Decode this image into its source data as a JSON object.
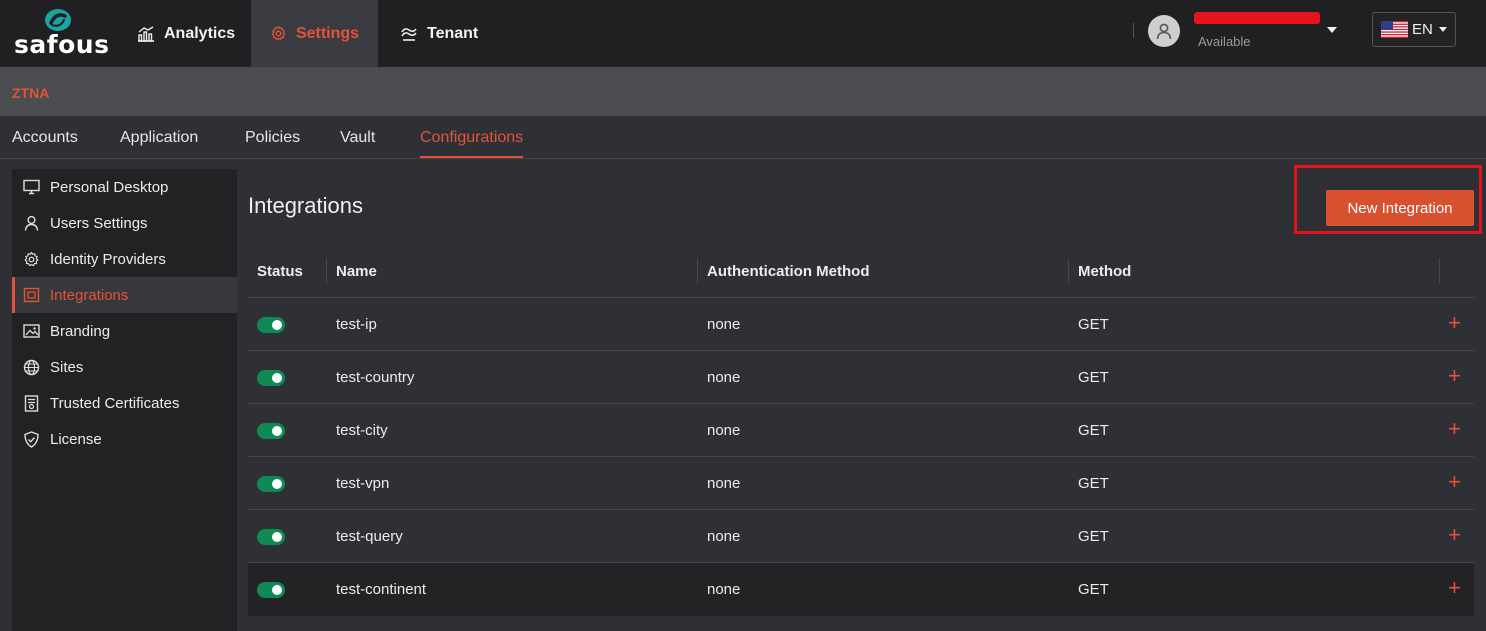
{
  "brand": {
    "name": "safous",
    "accent": "#e2533a"
  },
  "topnav": {
    "items": [
      {
        "label": "Analytics",
        "icon": "analytics-icon"
      },
      {
        "label": "Settings",
        "icon": "gear-icon",
        "active": true
      },
      {
        "label": "Tenant",
        "icon": "tenant-icon"
      }
    ]
  },
  "user": {
    "status": "Available"
  },
  "language": {
    "code": "EN"
  },
  "section": {
    "label": "ZTNA"
  },
  "tabs": [
    {
      "label": "Accounts"
    },
    {
      "label": "Application"
    },
    {
      "label": "Policies"
    },
    {
      "label": "Vault"
    },
    {
      "label": "Configurations",
      "active": true
    }
  ],
  "sidebar": {
    "items": [
      {
        "label": "Personal Desktop",
        "icon": "monitor-icon"
      },
      {
        "label": "Users Settings",
        "icon": "user-icon"
      },
      {
        "label": "Identity Providers",
        "icon": "gear-icon"
      },
      {
        "label": "Integrations",
        "icon": "integration-icon",
        "active": true
      },
      {
        "label": "Branding",
        "icon": "image-icon"
      },
      {
        "label": "Sites",
        "icon": "globe-icon"
      },
      {
        "label": "Trusted Certificates",
        "icon": "certificate-icon"
      },
      {
        "label": "License",
        "icon": "shield-icon"
      }
    ]
  },
  "main": {
    "title": "Integrations",
    "new_button_label": "New Integration"
  },
  "table": {
    "headers": {
      "status": "Status",
      "name": "Name",
      "auth": "Authentication Method",
      "method": "Method"
    },
    "rows": [
      {
        "enabled": true,
        "name": "test-ip",
        "auth": "none",
        "method": "GET"
      },
      {
        "enabled": true,
        "name": "test-country",
        "auth": "none",
        "method": "GET"
      },
      {
        "enabled": true,
        "name": "test-city",
        "auth": "none",
        "method": "GET"
      },
      {
        "enabled": true,
        "name": "test-vpn",
        "auth": "none",
        "method": "GET"
      },
      {
        "enabled": true,
        "name": "test-query",
        "auth": "none",
        "method": "GET"
      },
      {
        "enabled": true,
        "name": "test-continent",
        "auth": "none",
        "method": "GET"
      }
    ],
    "row_action": "+"
  }
}
